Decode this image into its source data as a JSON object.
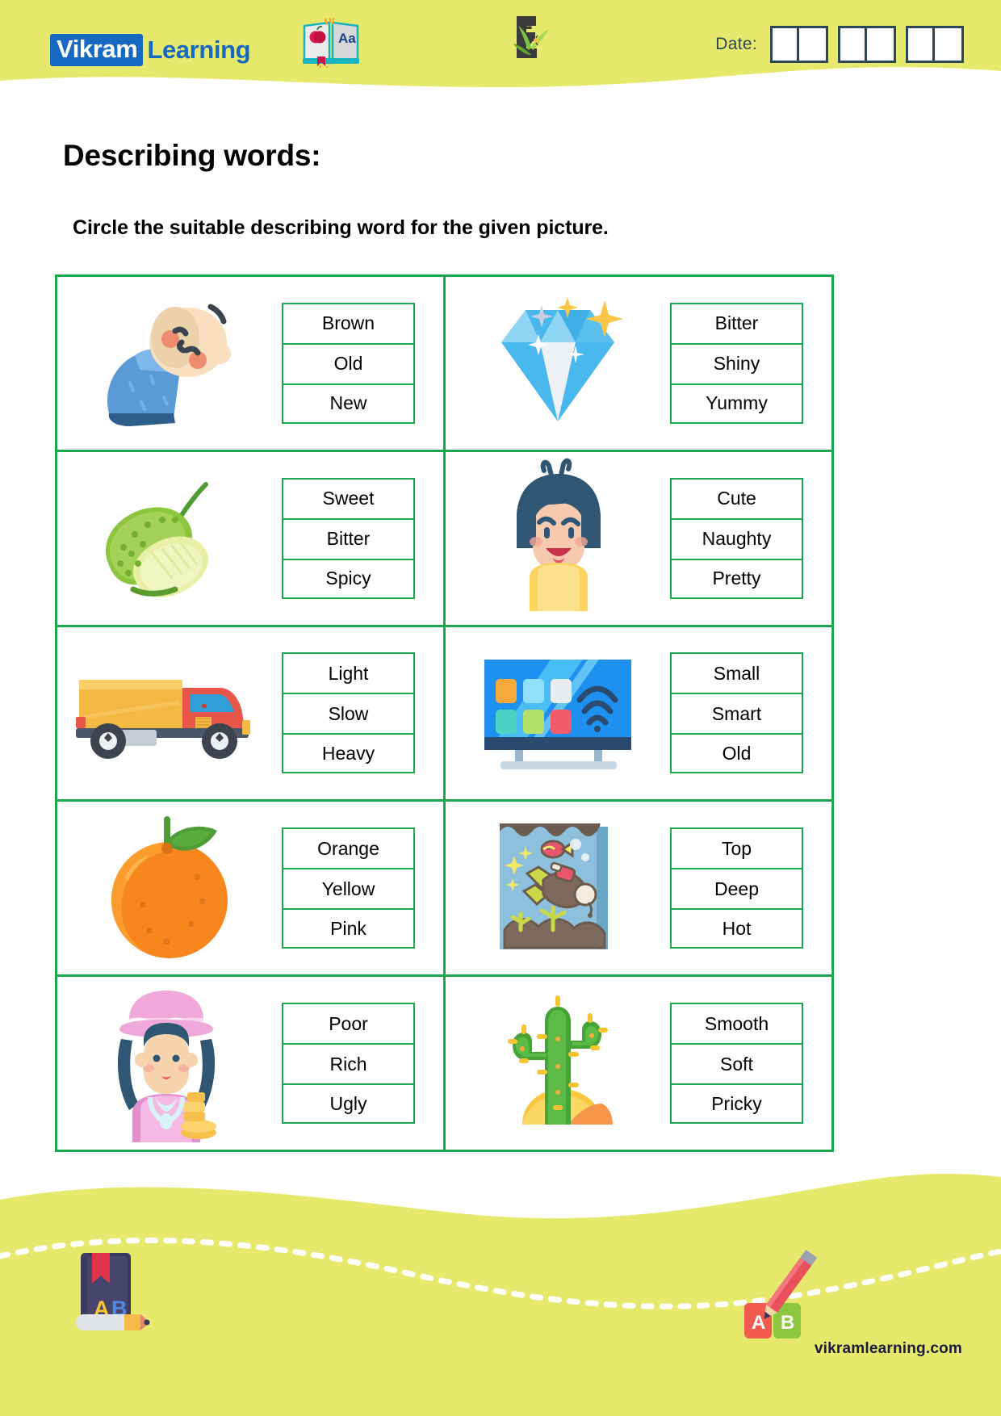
{
  "header": {
    "logo_badge": "Vikram",
    "logo_word": "Learning",
    "book_icon_letters": "Aa",
    "grade_icon_label": "5",
    "date_label": "Date:",
    "date_cells": [
      "",
      "",
      "",
      "",
      "",
      ""
    ],
    "bg_color": "#e6e96b",
    "logo_blue": "#1669c1",
    "date_border_color": "#2e4756"
  },
  "title": "Describing words:",
  "instruction": "Circle the suitable describing word for the given picture.",
  "table": {
    "border_color": "#1aa84f",
    "rows": [
      {
        "left": {
          "picture": "sleeping-baby-icon",
          "options": [
            "Brown",
            "Old",
            "New"
          ]
        },
        "right": {
          "picture": "diamond-icon",
          "options": [
            "Bitter",
            "Shiny",
            "Yummy"
          ]
        }
      },
      {
        "left": {
          "picture": "bitter-gourd-icon",
          "options": [
            "Sweet",
            "Bitter",
            "Spicy"
          ]
        },
        "right": {
          "picture": "naughty-girl-icon",
          "options": [
            "Cute",
            "Naughty",
            "Pretty"
          ]
        }
      },
      {
        "left": {
          "picture": "truck-icon",
          "options": [
            "Light",
            "Slow",
            "Heavy"
          ]
        },
        "right": {
          "picture": "smart-tv-icon",
          "options": [
            "Small",
            "Smart",
            "Old"
          ]
        }
      },
      {
        "left": {
          "picture": "orange-fruit-icon",
          "options": [
            "Orange",
            "Yellow",
            "Pink"
          ]
        },
        "right": {
          "picture": "scuba-diver-icon",
          "options": [
            "Top",
            "Deep",
            "Hot"
          ]
        }
      },
      {
        "left": {
          "picture": "rich-lady-icon",
          "options": [
            "Poor",
            "Rich",
            "Ugly"
          ]
        },
        "right": {
          "picture": "cactus-icon",
          "options": [
            "Smooth",
            "Soft",
            "Pricky"
          ]
        }
      }
    ]
  },
  "footer": {
    "website": "vikramlearning.com",
    "book_letters": [
      "A",
      "B"
    ],
    "block_letters": [
      "A",
      "B"
    ],
    "bg_color": "#e6e96b"
  }
}
